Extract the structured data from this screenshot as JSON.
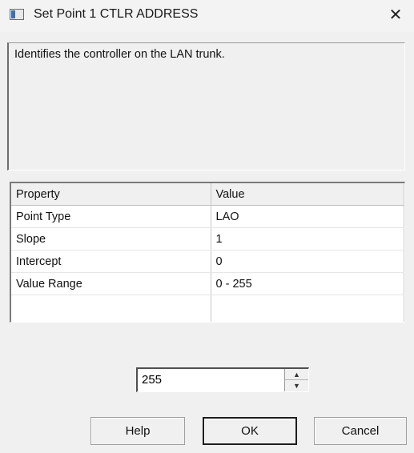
{
  "window": {
    "title": "Set Point 1  CTLR ADDRESS",
    "close_glyph": "✕"
  },
  "description": "Identifies the controller on the LAN trunk.",
  "properties": {
    "headers": [
      "Property",
      "Value"
    ],
    "rows": [
      [
        "Point Type",
        "LAO"
      ],
      [
        "Slope",
        "1"
      ],
      [
        "Intercept",
        "0"
      ],
      [
        "Value Range",
        "0 - 255"
      ]
    ]
  },
  "value_input": {
    "value": "255",
    "up_glyph": "▲",
    "down_glyph": "▼"
  },
  "buttons": {
    "help": "Help",
    "ok": "OK",
    "cancel": "Cancel"
  }
}
